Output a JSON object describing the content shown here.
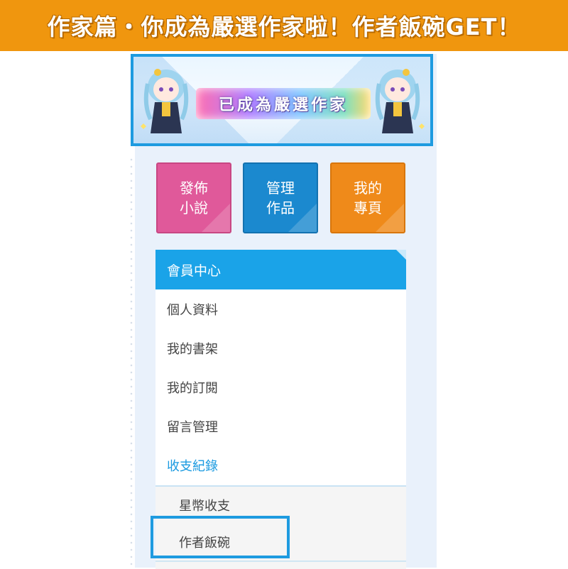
{
  "headline": "作家篇・你成為嚴選作家啦！作者飯碗GET！",
  "banner": {
    "text": "已成為嚴選作家"
  },
  "tiles": [
    {
      "label": "發佈小說",
      "color": "#e0599a"
    },
    {
      "label": "管理作品",
      "color": "#1b89cf"
    },
    {
      "label": "我的專頁",
      "color": "#ef8a1a"
    }
  ],
  "menu": {
    "header": "會員中心",
    "items": [
      {
        "label": "個人資料"
      },
      {
        "label": "我的書架"
      },
      {
        "label": "我的訂閱"
      },
      {
        "label": "留言管理"
      },
      {
        "label": "收支紀錄",
        "active": true
      }
    ],
    "submenu": [
      {
        "label": "星幣收支"
      },
      {
        "label": "作者飯碗",
        "highlighted": true
      }
    ]
  },
  "colors": {
    "accent": "#1aa3e8",
    "title_bar": "#f0960e",
    "highlight_border": "#1e9be0"
  }
}
